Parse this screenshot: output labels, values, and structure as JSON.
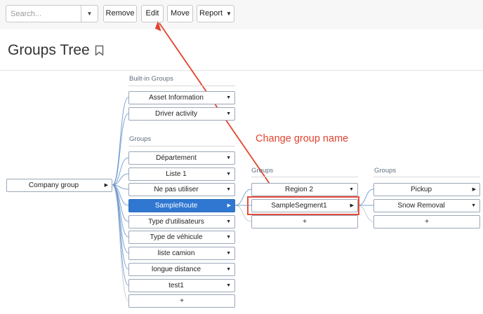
{
  "toolbar": {
    "search_placeholder": "Search...",
    "remove_label": "Remove",
    "edit_label": "Edit",
    "move_label": "Move",
    "report_label": "Report"
  },
  "page": {
    "title": "Groups Tree"
  },
  "root": {
    "label": "Company group"
  },
  "column1": {
    "builtin_header": "Built-in Groups",
    "builtin_items": [
      "Asset Information",
      "Driver activity"
    ],
    "groups_header": "Groups",
    "group_items": [
      "Département",
      "Liste 1",
      "Ne pas utiliser",
      "SampleRoute",
      "Type d'utilisateurs",
      "Type de véhicule",
      "liste camion",
      "longue distance",
      "test1"
    ],
    "selected": "SampleRoute",
    "add_label": "+"
  },
  "column2": {
    "header": "Groups",
    "items": [
      "Region 2",
      "SampleSegment1"
    ],
    "add_label": "+"
  },
  "column3": {
    "header": "Groups",
    "items": [
      "Pickup",
      "Snow Removal"
    ],
    "add_label": "+"
  },
  "annotation": {
    "text": "Change group name"
  },
  "colors": {
    "selected": "#2f77d0",
    "annotation": "#e2432f",
    "connector": "#4f86c6"
  }
}
